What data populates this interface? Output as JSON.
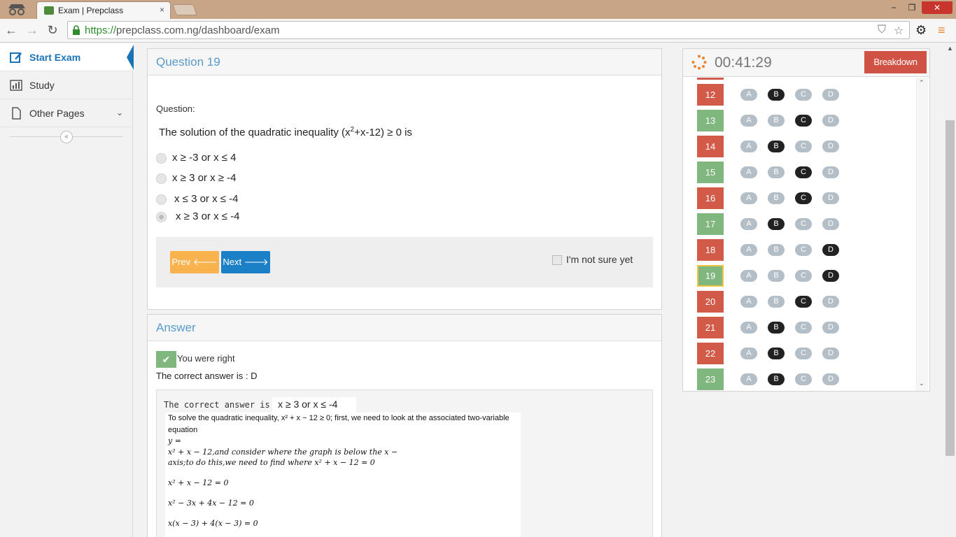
{
  "browser": {
    "tab_title": "Exam | Prepclass",
    "tab_close": "×",
    "url_protocol": "https://",
    "url_rest": "prepclass.com.ng/dashboard/exam",
    "window_controls": {
      "minimize": "−",
      "maximize": "❐",
      "close": "✕"
    }
  },
  "sidebar": {
    "items": [
      {
        "label": "Start Exam",
        "icon": "edit-icon",
        "active": true
      },
      {
        "label": "Study",
        "icon": "bar-chart-icon"
      },
      {
        "label": "Other Pages",
        "icon": "file-icon",
        "chevron": "⌄"
      }
    ],
    "collapse_label": "«"
  },
  "question": {
    "heading": "Question 19",
    "label": "Question:",
    "text_prefix": "The solution of the quadratic inequality (x",
    "text_sup": "2",
    "text_suffix": "+x-12) ≥ 0 is",
    "options": [
      {
        "text": "x ≥ -3 or x ≤ 4",
        "checked": false
      },
      {
        "text": "x ≥ 3 or x ≥ -4",
        "checked": false
      },
      {
        "text": "x ≤ 3 or x ≤ -4",
        "checked": false
      },
      {
        "text": "x ≥ 3 or x ≤ -4",
        "checked": true
      }
    ],
    "prev_label": "Prev",
    "next_label": "Next",
    "not_sure_label": "I'm not sure yet"
  },
  "answer": {
    "heading": "Answer",
    "result": "You were right",
    "correct": "The correct answer is : D",
    "explanation_lead": "The correct answer is",
    "explanation_answer": "x ≥ 3 or x ≤ -4",
    "explanation_lines": [
      "To solve the quadratic inequality, x² + x − 12 ≥ 0; first, we need to look at the associated two-variable",
      "equation",
      "y =",
      "x² + x − 12,and consider where the graph is below the x −",
      "axis;to do this,we need to find where x² + x − 12 = 0",
      "x² + x − 12 = 0",
      "x² − 3x + 4x − 12 = 0",
      "x(x − 3) + 4(x − 3) = 0"
    ]
  },
  "navigator": {
    "timer": "00:41:29",
    "breakdown_label": "Breakdown",
    "rows": [
      {
        "num": "12",
        "status": "red",
        "selected": "B"
      },
      {
        "num": "13",
        "status": "green",
        "selected": "C"
      },
      {
        "num": "14",
        "status": "red",
        "selected": "B"
      },
      {
        "num": "15",
        "status": "green",
        "selected": "C"
      },
      {
        "num": "16",
        "status": "red",
        "selected": "C"
      },
      {
        "num": "17",
        "status": "green",
        "selected": "B"
      },
      {
        "num": "18",
        "status": "red",
        "selected": "D"
      },
      {
        "num": "19",
        "status": "green",
        "selected": "D",
        "current": true
      },
      {
        "num": "20",
        "status": "red",
        "selected": "C"
      },
      {
        "num": "21",
        "status": "red",
        "selected": "B"
      },
      {
        "num": "22",
        "status": "red",
        "selected": "B"
      },
      {
        "num": "23",
        "status": "green",
        "selected": "B"
      }
    ],
    "choices": [
      "A",
      "B",
      "C",
      "D"
    ]
  },
  "colors": {
    "accent_blue": "#1c80c7",
    "heading_blue": "#5a9bc8",
    "wrong_red": "#d15b48",
    "right_green": "#7fb77e",
    "prev_orange": "#f9b34e"
  }
}
